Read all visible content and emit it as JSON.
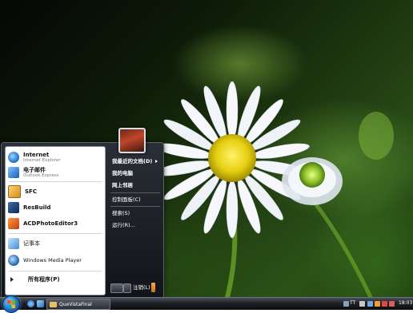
{
  "start_menu": {
    "programs": [
      {
        "title": "Internet",
        "subtitle": "Internet Explorer",
        "icon": "internet-explorer-icon"
      },
      {
        "title": "电子邮件",
        "subtitle": "Outlook Express",
        "icon": "outlook-express-icon"
      },
      {
        "title": "SFC",
        "icon": "sfc-icon"
      },
      {
        "title": "ResBuild",
        "icon": "resbuild-icon"
      },
      {
        "title": "ACDPhotoEditor3",
        "icon": "acd-photo-editor-icon"
      },
      {
        "title": "记事本",
        "icon": "notepad-icon"
      },
      {
        "title": "Windows Media Player",
        "icon": "media-player-icon"
      }
    ],
    "all_programs": "所有程序(P)",
    "right_items": {
      "recent_documents": "我最近的文档(D)",
      "my_computer": "我的电脑",
      "network_places": "网上邻居",
      "control_panel": "控制面板(C)",
      "search": "搜索(S)",
      "run": "运行(R)..."
    },
    "log_off": "注销(L)"
  },
  "taskbar": {
    "task_button": "QueVistaFinal",
    "ime": "TT",
    "clock": "18:03"
  }
}
